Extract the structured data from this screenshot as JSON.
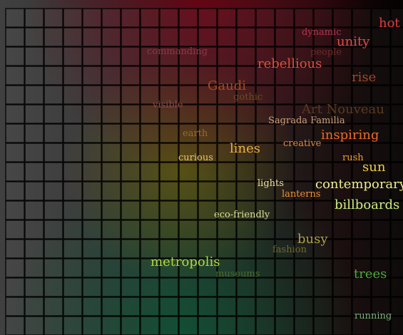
{
  "words": [
    {
      "text": "hot",
      "color": "#e23a3a",
      "size": "large"
    },
    {
      "text": "dynamic",
      "color": "#b33550",
      "size": "small"
    },
    {
      "text": "unity",
      "color": "#e24a4a",
      "size": "large"
    },
    {
      "text": "commanding",
      "color": "#8a3a4a",
      "size": "small"
    },
    {
      "text": "people",
      "color": "#6e2a2a",
      "size": "small"
    },
    {
      "text": "rebellious",
      "color": "#e2503a",
      "size": "large"
    },
    {
      "text": "rise",
      "color": "#a04a2a",
      "size": "large"
    },
    {
      "text": "Gaudi",
      "color": "#a84a1e",
      "size": "large"
    },
    {
      "text": "gothic",
      "color": "#6e4a1a",
      "size": "small"
    },
    {
      "text": "visible",
      "color": "#8a4a4a",
      "size": "small"
    },
    {
      "text": "Art Nouveau",
      "color": "#5a3a1e",
      "size": "large"
    },
    {
      "text": "Sagrada Familia",
      "color": "#c8a078",
      "size": "small"
    },
    {
      "text": "earth",
      "color": "#9a6a2a",
      "size": "small"
    },
    {
      "text": "inspiring",
      "color": "#ee6a28",
      "size": "large"
    },
    {
      "text": "creative",
      "color": "#ee8a3a",
      "size": "small"
    },
    {
      "text": "lines",
      "color": "#eeb040",
      "size": "large"
    },
    {
      "text": "curious",
      "color": "#eec070",
      "size": "small"
    },
    {
      "text": "rush",
      "color": "#ee9a30",
      "size": "small"
    },
    {
      "text": "sun",
      "color": "#eed040",
      "size": "large"
    },
    {
      "text": "lights",
      "color": "#eee0a0",
      "size": "small"
    },
    {
      "text": "contemporary",
      "color": "#eeee90",
      "size": "large"
    },
    {
      "text": "lanterns",
      "color": "#ee9030",
      "size": "small"
    },
    {
      "text": "billboards",
      "color": "#ccee80",
      "size": "large"
    },
    {
      "text": "eco-friendly",
      "color": "#dcdc98",
      "size": "small"
    },
    {
      "text": "busy",
      "color": "#b0a040",
      "size": "large"
    },
    {
      "text": "fashion",
      "color": "#6e6a2a",
      "size": "small"
    },
    {
      "text": "metropolis",
      "color": "#b0d840",
      "size": "large"
    },
    {
      "text": "museums",
      "color": "#4e6a2a",
      "size": "small"
    },
    {
      "text": "trees",
      "color": "#4aaa3a",
      "size": "large"
    },
    {
      "text": "running",
      "color": "#7ab07a",
      "size": "small"
    }
  ]
}
